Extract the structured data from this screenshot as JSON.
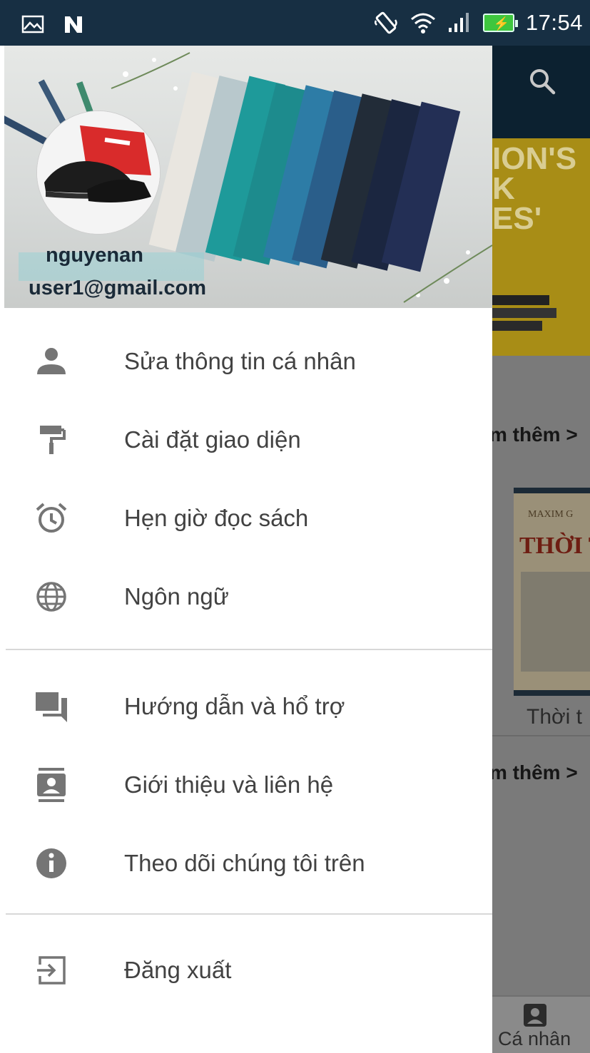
{
  "status_bar": {
    "time": "17:54",
    "left_icons": [
      "image-icon",
      "n-notification-icon"
    ],
    "right_icons": [
      "vibrate-icon",
      "wifi-icon",
      "signal-icon",
      "battery-charging-icon"
    ]
  },
  "drawer": {
    "profile": {
      "username": "nguyenan",
      "email": "user1@gmail.com",
      "avatar": "shoe-avatar"
    },
    "group1": [
      {
        "icon": "person-icon",
        "label": "Sửa thông tin cá nhân"
      },
      {
        "icon": "paint-roller-icon",
        "label": "Cài đặt giao diện"
      },
      {
        "icon": "alarm-icon",
        "label": "Hẹn giờ đọc sách"
      },
      {
        "icon": "globe-icon",
        "label": "Ngôn ngữ"
      }
    ],
    "group2": [
      {
        "icon": "chat-icon",
        "label": "Hướng dẫn và hổ trợ"
      },
      {
        "icon": "contact-card-icon",
        "label": "Giới thiệu và liên hệ"
      },
      {
        "icon": "info-icon",
        "label": "Theo dõi chúng tôi trên"
      }
    ],
    "group3": [
      {
        "icon": "logout-icon",
        "label": "Đăng xuất"
      }
    ]
  },
  "background_app": {
    "see_more_1": "m thêm >",
    "see_more_2": "m thêm >",
    "card_caption": "Thời t",
    "card_cover_title": "THỜI TH",
    "card_cover_author": "MAXIM G",
    "bottom_nav_label": "Cá nhân",
    "banner_text": "ION'S\nK\nES'"
  },
  "colors": {
    "status_bar": "#172f43",
    "icon_gray": "#757575",
    "text_gray": "#424242",
    "header_text": "#1a2a38"
  }
}
